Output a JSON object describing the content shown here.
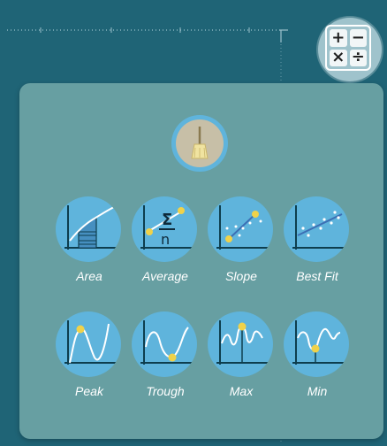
{
  "calculator": {
    "plus": "+",
    "minus": "−",
    "times": "×",
    "divide": "÷"
  },
  "tools": {
    "area": "Area",
    "average": "Average",
    "slope": "Slope",
    "best_fit": "Best Fit",
    "peak": "Peak",
    "trough": "Trough",
    "max": "Max",
    "min": "Min"
  },
  "icons": {
    "calculator": "calculator-icon",
    "broom": "broom-icon",
    "area": "area-under-curve-icon",
    "average": "sigma-average-icon",
    "slope": "slope-line-icon",
    "best_fit": "best-fit-line-icon",
    "peak": "peak-curve-icon",
    "trough": "trough-curve-icon",
    "max": "max-curve-icon",
    "min": "min-curve-icon"
  },
  "colors": {
    "background": "#1f6476",
    "panel": "#679fa2",
    "tool_circle": "#5fb4dc",
    "marker": "#f0d24a",
    "broom_face": "#c7bfa7"
  }
}
